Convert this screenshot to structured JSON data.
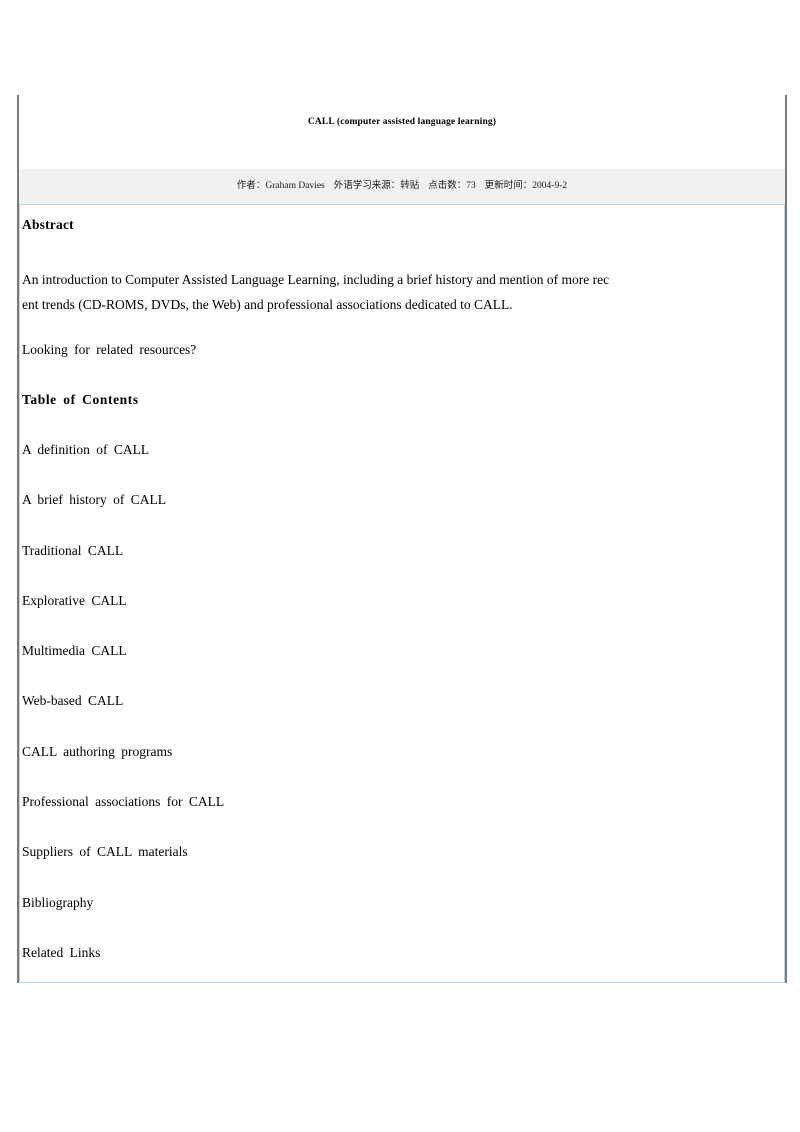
{
  "document": {
    "title": "CALL (computer assisted language learning)",
    "meta": {
      "author_label": "作者：",
      "author_value": "Graham Davies",
      "source_label": "外语学习来源：",
      "source_value": "转贴",
      "hits_label": "点击数：",
      "hits_value": "73",
      "updated_label": "更新时间：",
      "updated_value": "2004-9-2"
    },
    "abstract": {
      "heading": "Abstract",
      "paragraph": "An introduction to Computer Assisted Language Learning, including a brief history and mention of more recent trends (CD-ROMS, DVDs, the Web) and professional associations dedicated to CALL.",
      "line1": "An introduction to Computer Assisted Language Learning, including a brief history and mention of more rec",
      "line2": "ent trends (CD-ROMS, DVDs, the Web) and professional associations dedicated to CALL.",
      "resources_prompt": "Looking for related resources?"
    },
    "table_of_contents": {
      "heading": "Table of Contents",
      "items": [
        "A definition of CALL",
        "A brief history of CALL",
        "Traditional CALL",
        "Explorative CALL",
        "Multimedia CALL",
        "Web-based CALL",
        "CALL authoring programs",
        "Professional associations for CALL",
        "Suppliers of CALL materials",
        "Bibliography",
        "Related Links"
      ]
    },
    "colors": {
      "outer_border": "#7a7a7a",
      "meta_band": "#f1f1f1",
      "content_border": "#b9d6e2",
      "text": "#000000",
      "page_background": "#ffffff"
    }
  }
}
